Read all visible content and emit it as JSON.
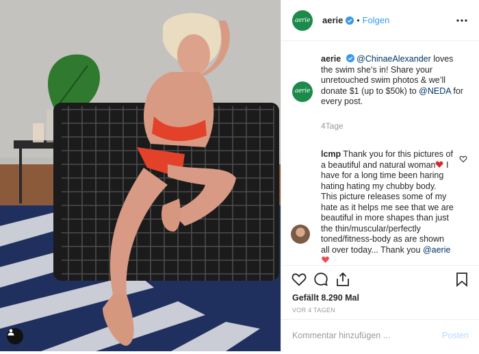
{
  "account": {
    "username": "aerie",
    "avatar_text": "aerie",
    "follow_label": "Folgen",
    "separator": "•"
  },
  "caption": {
    "username": "aerie",
    "mention_1": "@ChinaeAlexander",
    "text_1": " loves the swim she’s in! Share your unretouched swim photos & we’ll donate $1 (up to $50k) to ",
    "mention_2": "@NEDA",
    "text_2": " for every post.",
    "time_ago": "4Tage"
  },
  "comment": {
    "username": "lcmp",
    "text_1": " Thank you for this pictures of a beautiful and natural woman",
    "text_2": " I have for a long time been haring hating hating my chubby body. This picture releases some of my hate as it helps me see that we are beautiful in more shapes than just the thin/muscular/perfectly toned/fitness-body as are shown all over today... Thank you ",
    "mention": "@aerie"
  },
  "stats": {
    "likes": "Gefällt 8.290 Mal",
    "age": "VOR 4 TAGEN"
  },
  "composer": {
    "placeholder": "Kommentar hinzufügen ...",
    "post_label": "Posten"
  },
  "colors": {
    "brand_green": "#1b8a4a",
    "link_blue": "#3897f0",
    "mention_blue": "#003569",
    "verified_blue": "#3897f0",
    "heart_red": "#ed4956"
  },
  "icons": {
    "more": "more-horizontal-icon",
    "like": "heart-icon",
    "comment": "comment-icon",
    "share": "share-icon",
    "save": "bookmark-icon",
    "tag": "user-tag-icon"
  }
}
